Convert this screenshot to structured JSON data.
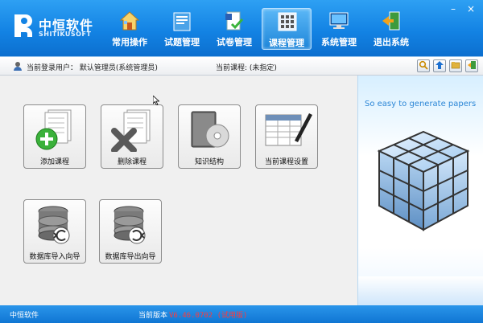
{
  "app": {
    "logo_cn": "中恒软件",
    "logo_en": "SHITIKUSOFT"
  },
  "menu": [
    {
      "label": "常用操作",
      "icon": "home-icon"
    },
    {
      "label": "试题管理",
      "icon": "question-bank-icon"
    },
    {
      "label": "试卷管理",
      "icon": "exam-paper-icon"
    },
    {
      "label": "课程管理",
      "icon": "course-icon",
      "active": true
    },
    {
      "label": "系统管理",
      "icon": "system-settings-icon"
    },
    {
      "label": "退出系统",
      "icon": "exit-icon"
    }
  ],
  "window_controls": {
    "minimize": "–",
    "close": "×"
  },
  "infobar": {
    "user_text": "当前登录用户：  默认管理员(系统管理员)",
    "course_text": "当前课程: (未指定)",
    "tools": [
      "search-icon",
      "upload-icon",
      "folder-icon",
      "exit-icon"
    ]
  },
  "tiles": [
    {
      "label": "添加课程",
      "icon": "add-course-icon"
    },
    {
      "label": "删除课程",
      "icon": "delete-course-icon"
    },
    {
      "label": "知识结构",
      "icon": "knowledge-structure-icon"
    },
    {
      "label": "当前课程设置",
      "icon": "current-course-settings-icon"
    },
    {
      "label": "数据库导入向导",
      "icon": "database-import-icon"
    },
    {
      "label": "数据库导出向导",
      "icon": "database-export-icon"
    }
  ],
  "banner": {
    "slogan": "So easy to generate papers"
  },
  "status": {
    "company": "中恒软件",
    "version_label": "当前版本",
    "version": "V6.46.0702 (试用版)"
  },
  "colors": {
    "accent": "#1a7fd6",
    "version_red": "#ff3b3b"
  }
}
